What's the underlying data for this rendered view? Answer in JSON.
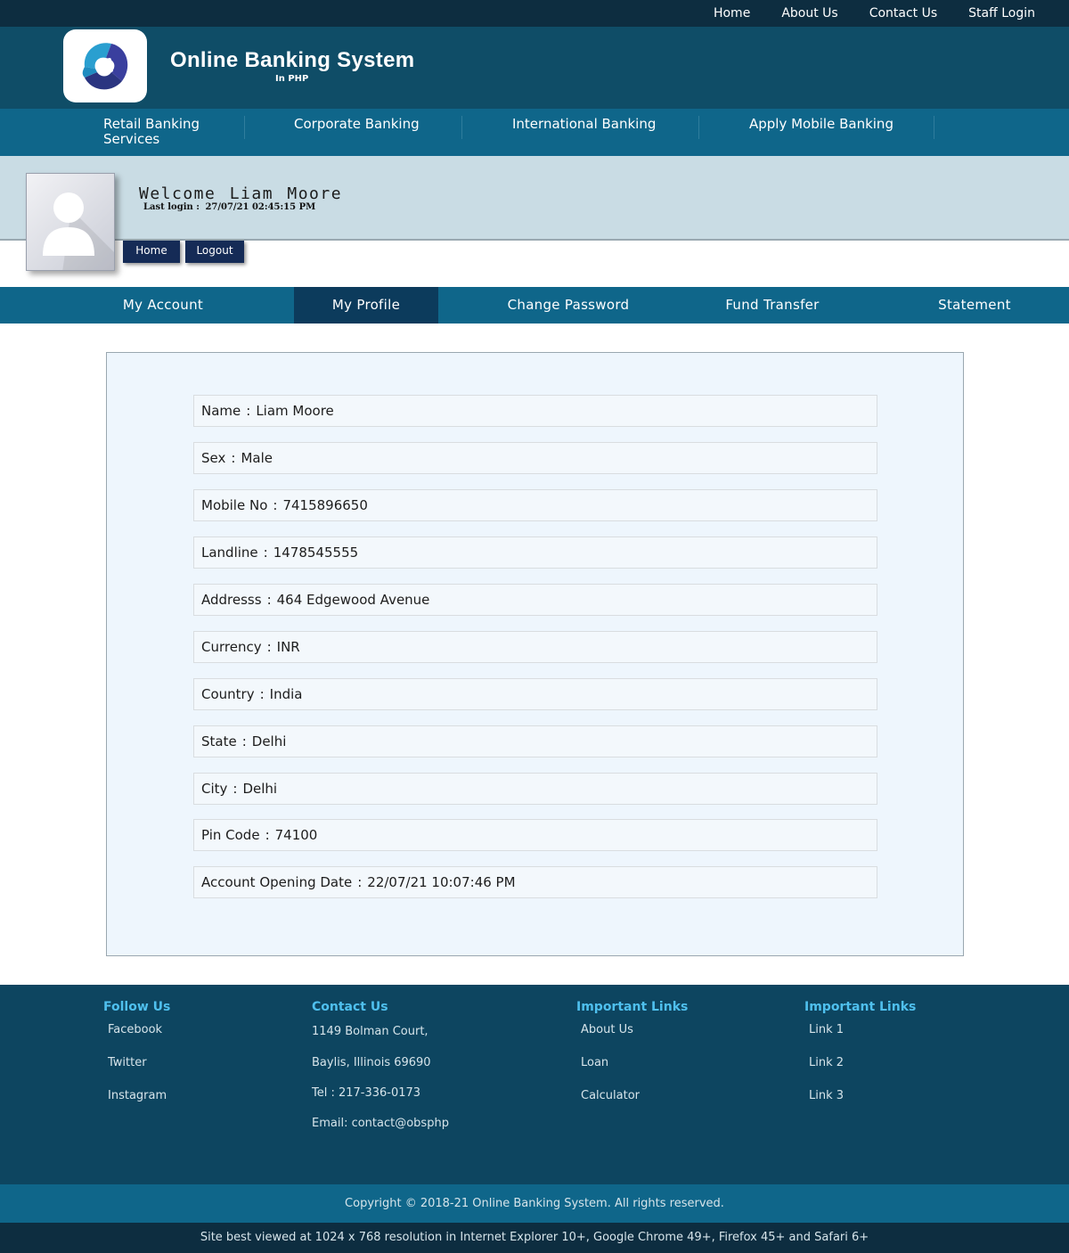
{
  "topnav": {
    "home": "Home",
    "about": "About Us",
    "contact": "Contact Us",
    "staff": "Staff Login"
  },
  "brand": {
    "title": "Online Banking System",
    "subtitle": "In PHP"
  },
  "service_nav": {
    "retail": "Retail Banking Services",
    "corporate": "Corporate Banking",
    "international": "International Banking",
    "mobile": "Apply Mobile Banking"
  },
  "welcome": {
    "greeting": "Welcome  Liam  Moore",
    "last_login_label": "Last login :",
    "last_login_value": "27/07/21 02:45:15 PM",
    "home_button": "Home",
    "logout_button": "Logout"
  },
  "account_nav": {
    "my_account": "My Account",
    "my_profile": "My Profile",
    "change_password": "Change Password",
    "fund_transfer": "Fund Transfer",
    "statement": "Statement"
  },
  "profile": {
    "rows": [
      {
        "label": "Name",
        "value": "Liam Moore"
      },
      {
        "label": "Sex",
        "value": "Male"
      },
      {
        "label": "Mobile No",
        "value": "7415896650"
      },
      {
        "label": "Landline",
        "value": "1478545555"
      },
      {
        "label": "Addresss",
        "value": "464 Edgewood Avenue"
      },
      {
        "label": "Currency",
        "value": "INR"
      },
      {
        "label": "Country",
        "value": "India"
      },
      {
        "label": "State",
        "value": "Delhi"
      },
      {
        "label": "City",
        "value": "Delhi"
      },
      {
        "label": "Pin Code",
        "value": "74100"
      },
      {
        "label": "Account Opening Date",
        "value": "22/07/21 10:07:46 PM"
      }
    ]
  },
  "footer": {
    "follow": {
      "heading": "Follow Us",
      "links": [
        "Facebook",
        "Twitter",
        "Instagram"
      ]
    },
    "contact": {
      "heading": "Contact Us",
      "lines": [
        "1149 Bolman Court,",
        "Baylis, Illinois 69690",
        "Tel : 217-336-0173",
        "Email: contact@obsphp"
      ]
    },
    "important1": {
      "heading": "Important Links",
      "links": [
        "About Us",
        "Loan",
        "Calculator"
      ]
    },
    "important2": {
      "heading": "Important Links",
      "links": [
        "Link 1",
        "Link 2",
        "Link 3"
      ]
    },
    "copyright": "Copyright © 2018-21 Online Banking System. All rights reserved.",
    "best_view": "Site best viewed at 1024 x 768 resolution in Internet Explorer 10+, Google Chrome 49+, Firefox 45+ and Safari 6+"
  },
  "colors": {
    "topbar": "#0d2d40",
    "header": "#0f4d67",
    "nav": "#0f668a",
    "active_tab": "#0c3b5c",
    "footer_heading": "#4fc0ee"
  }
}
